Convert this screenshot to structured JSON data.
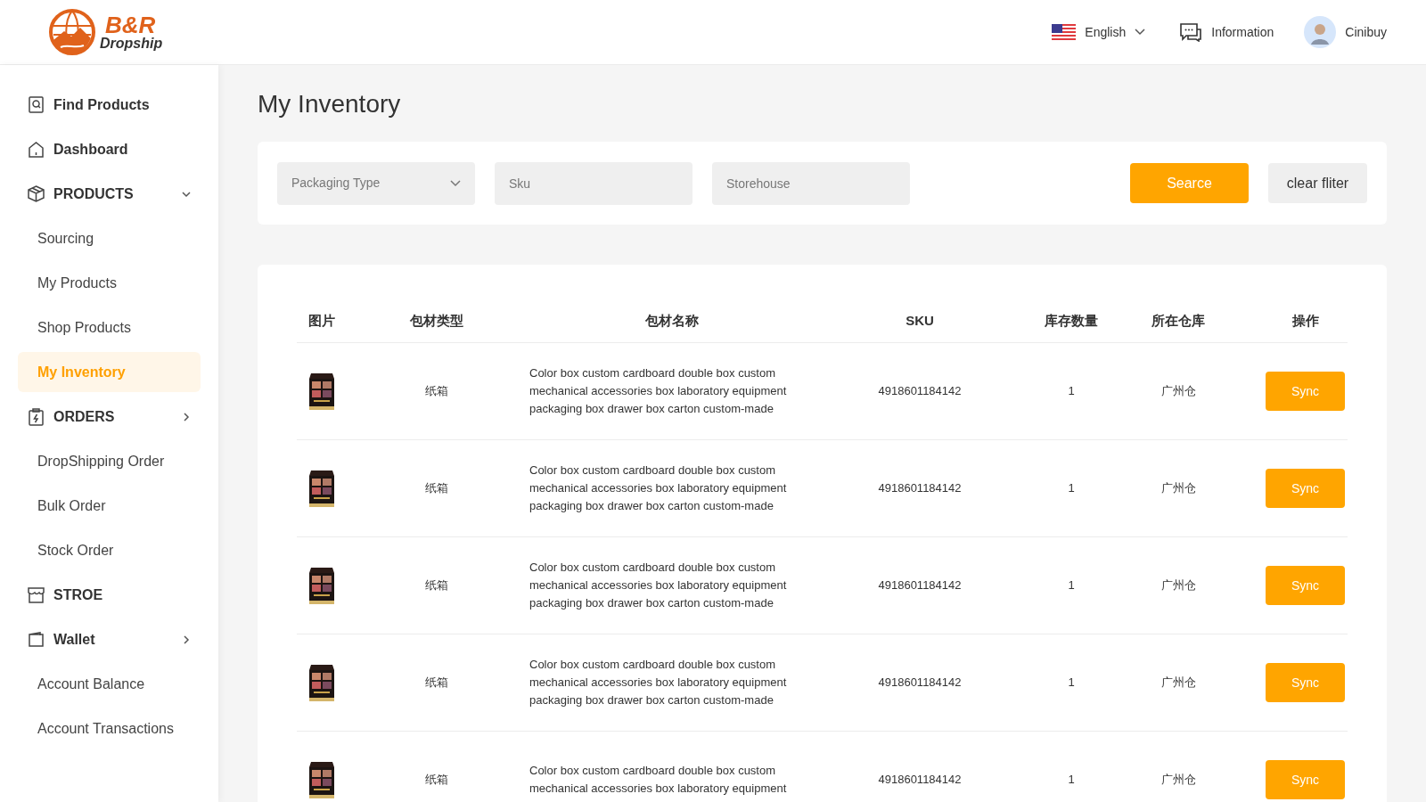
{
  "header": {
    "logo": {
      "brand": "B&R",
      "tagline": "Dropship"
    },
    "language": "English",
    "information": "Information",
    "user": "Cinibuy"
  },
  "sidebar": {
    "items": [
      {
        "kind": "link",
        "label": "Find Products"
      },
      {
        "kind": "link",
        "label": "Dashboard"
      },
      {
        "kind": "group",
        "label": "PRODUCTS",
        "expanded": true
      },
      {
        "kind": "sub",
        "label": "Sourcing",
        "selected": false
      },
      {
        "kind": "sub",
        "label": "My Products",
        "selected": false
      },
      {
        "kind": "sub",
        "label": "Shop Products",
        "selected": false
      },
      {
        "kind": "sub",
        "label": "My Inventory",
        "selected": true
      },
      {
        "kind": "group",
        "label": "ORDERS",
        "expanded": false
      },
      {
        "kind": "sub",
        "label": "DropShipping Order",
        "selected": false
      },
      {
        "kind": "sub",
        "label": "Bulk Order",
        "selected": false
      },
      {
        "kind": "sub",
        "label": "Stock Order",
        "selected": false
      },
      {
        "kind": "link",
        "label": "STROE"
      },
      {
        "kind": "group",
        "label": "Wallet",
        "expanded": false
      },
      {
        "kind": "sub",
        "label": "Account Balance",
        "selected": false
      },
      {
        "kind": "sub",
        "label": "Account Transactions",
        "selected": false
      }
    ]
  },
  "page_title": "My Inventory",
  "filters": {
    "packaging_type": {
      "placeholder": "Packaging Type"
    },
    "sku": {
      "placeholder": "Sku"
    },
    "storehouse": {
      "placeholder": "Storehouse"
    },
    "search_button": "Searce",
    "clear_button": "clear fliter"
  },
  "table": {
    "columns": [
      "图片",
      "包材类型",
      "包材名称",
      "SKU",
      "库存数量",
      "所在仓库",
      "操作"
    ],
    "rows": [
      {
        "type": "纸箱",
        "name": "Color box custom cardboard double box custom mechanical accessories box laboratory equipment packaging box drawer box carton custom-made",
        "sku": "4918601184142",
        "quantity": "1",
        "warehouse": "广州仓",
        "action": "Sync"
      },
      {
        "type": "纸箱",
        "name": "Color box custom cardboard double box custom mechanical accessories box laboratory equipment packaging box drawer box carton custom-made",
        "sku": "4918601184142",
        "quantity": "1",
        "warehouse": "广州仓",
        "action": "Sync"
      },
      {
        "type": "纸箱",
        "name": "Color box custom cardboard double box custom mechanical accessories box laboratory equipment packaging box drawer box carton custom-made",
        "sku": "4918601184142",
        "quantity": "1",
        "warehouse": "广州仓",
        "action": "Sync"
      },
      {
        "type": "纸箱",
        "name": "Color box custom cardboard double box custom mechanical accessories box laboratory equipment packaging box drawer box carton custom-made",
        "sku": "4918601184142",
        "quantity": "1",
        "warehouse": "广州仓",
        "action": "Sync"
      },
      {
        "type": "纸箱",
        "name": "Color box custom cardboard double box custom mechanical accessories box laboratory equipment",
        "sku": "4918601184142",
        "quantity": "1",
        "warehouse": "广州仓",
        "action": "Sync"
      }
    ]
  }
}
